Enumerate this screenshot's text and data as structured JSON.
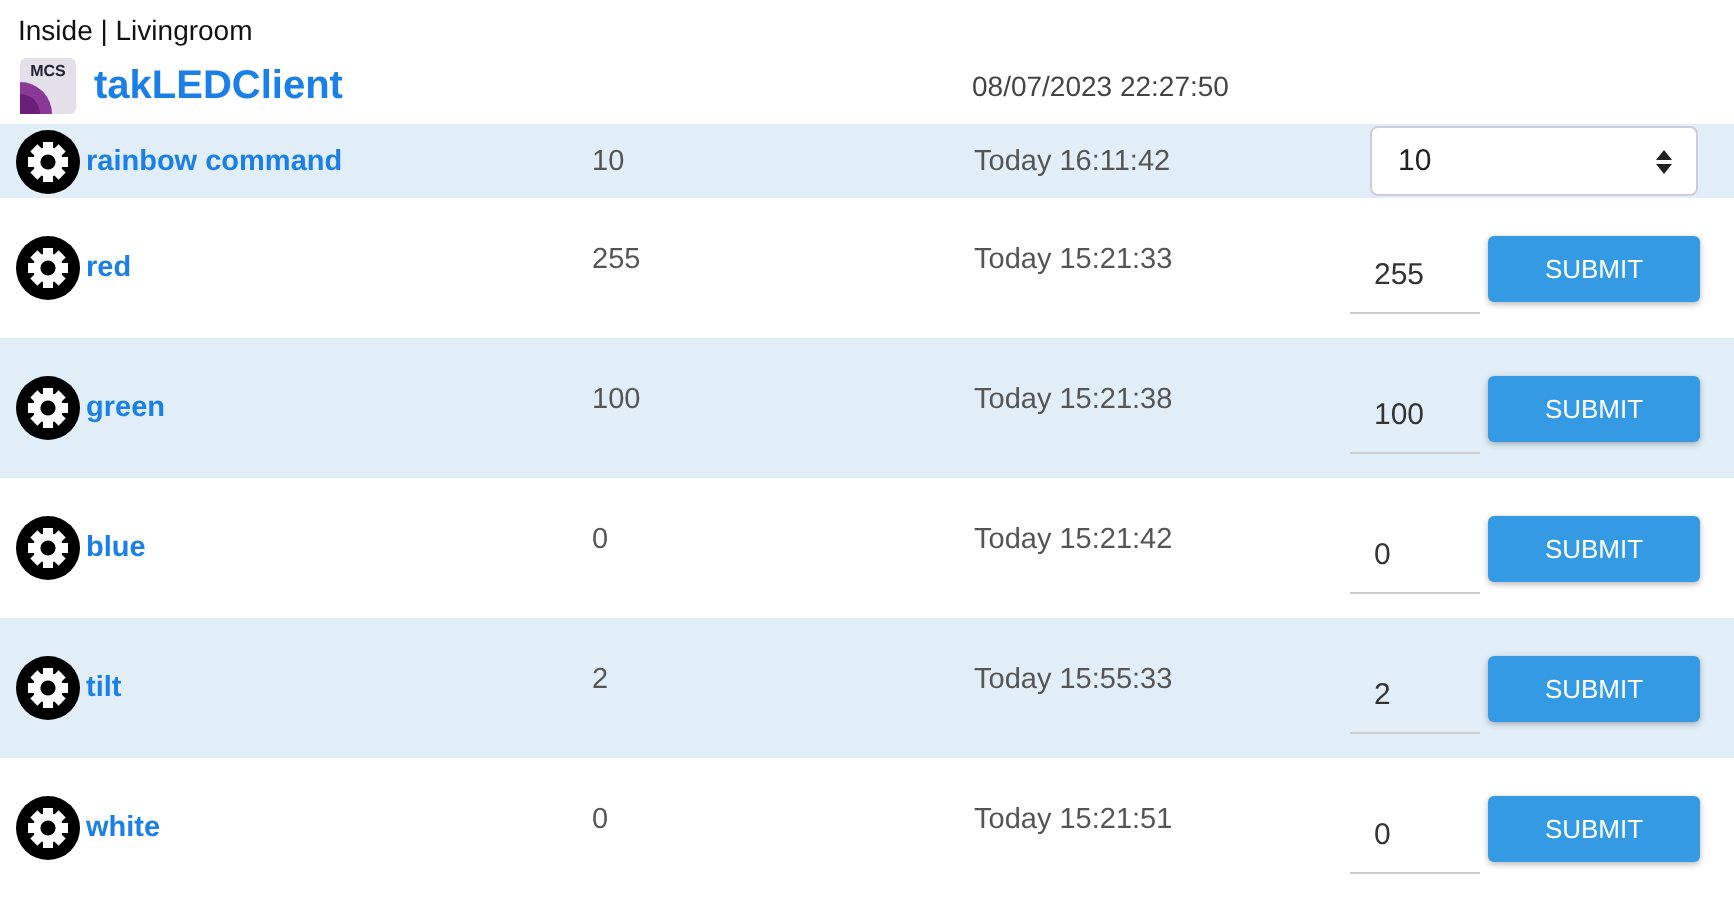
{
  "location": "Inside | Livingroom",
  "app": {
    "logo_text": "MCS",
    "title": "takLEDClient",
    "timestamp": "08/07/2023 22:27:50"
  },
  "rows": [
    {
      "kind": "select",
      "name": "rainbow command",
      "value": "10",
      "time": "Today 16:11:42",
      "control_value": "10"
    },
    {
      "kind": "input",
      "name": "red",
      "value": "255",
      "time": "Today 15:21:33",
      "control_value": "255",
      "button": "SUBMIT"
    },
    {
      "kind": "input",
      "name": "green",
      "value": "100",
      "time": "Today 15:21:38",
      "control_value": "100",
      "button": "SUBMIT"
    },
    {
      "kind": "input",
      "name": "blue",
      "value": "0",
      "time": "Today 15:21:42",
      "control_value": "0",
      "button": "SUBMIT"
    },
    {
      "kind": "input",
      "name": "tilt",
      "value": "2",
      "time": "Today 15:55:33",
      "control_value": "2",
      "button": "SUBMIT"
    },
    {
      "kind": "input",
      "name": "white",
      "value": "0",
      "time": "Today 15:21:51",
      "control_value": "0",
      "button": "SUBMIT"
    }
  ]
}
